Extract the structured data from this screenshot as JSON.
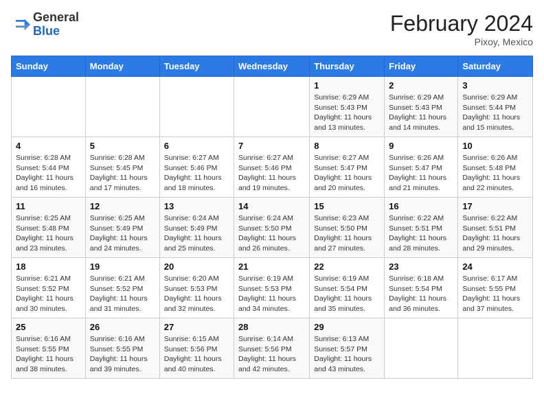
{
  "header": {
    "logo_general": "General",
    "logo_blue": "Blue",
    "month_year": "February 2024",
    "location": "Pixoy, Mexico"
  },
  "days_of_week": [
    "Sunday",
    "Monday",
    "Tuesday",
    "Wednesday",
    "Thursday",
    "Friday",
    "Saturday"
  ],
  "weeks": [
    [
      {
        "day": "",
        "info": ""
      },
      {
        "day": "",
        "info": ""
      },
      {
        "day": "",
        "info": ""
      },
      {
        "day": "",
        "info": ""
      },
      {
        "day": "1",
        "info": "Sunrise: 6:29 AM\nSunset: 5:43 PM\nDaylight: 11 hours and 13 minutes."
      },
      {
        "day": "2",
        "info": "Sunrise: 6:29 AM\nSunset: 5:43 PM\nDaylight: 11 hours and 14 minutes."
      },
      {
        "day": "3",
        "info": "Sunrise: 6:29 AM\nSunset: 5:44 PM\nDaylight: 11 hours and 15 minutes."
      }
    ],
    [
      {
        "day": "4",
        "info": "Sunrise: 6:28 AM\nSunset: 5:44 PM\nDaylight: 11 hours and 16 minutes."
      },
      {
        "day": "5",
        "info": "Sunrise: 6:28 AM\nSunset: 5:45 PM\nDaylight: 11 hours and 17 minutes."
      },
      {
        "day": "6",
        "info": "Sunrise: 6:27 AM\nSunset: 5:46 PM\nDaylight: 11 hours and 18 minutes."
      },
      {
        "day": "7",
        "info": "Sunrise: 6:27 AM\nSunset: 5:46 PM\nDaylight: 11 hours and 19 minutes."
      },
      {
        "day": "8",
        "info": "Sunrise: 6:27 AM\nSunset: 5:47 PM\nDaylight: 11 hours and 20 minutes."
      },
      {
        "day": "9",
        "info": "Sunrise: 6:26 AM\nSunset: 5:47 PM\nDaylight: 11 hours and 21 minutes."
      },
      {
        "day": "10",
        "info": "Sunrise: 6:26 AM\nSunset: 5:48 PM\nDaylight: 11 hours and 22 minutes."
      }
    ],
    [
      {
        "day": "11",
        "info": "Sunrise: 6:25 AM\nSunset: 5:48 PM\nDaylight: 11 hours and 23 minutes."
      },
      {
        "day": "12",
        "info": "Sunrise: 6:25 AM\nSunset: 5:49 PM\nDaylight: 11 hours and 24 minutes."
      },
      {
        "day": "13",
        "info": "Sunrise: 6:24 AM\nSunset: 5:49 PM\nDaylight: 11 hours and 25 minutes."
      },
      {
        "day": "14",
        "info": "Sunrise: 6:24 AM\nSunset: 5:50 PM\nDaylight: 11 hours and 26 minutes."
      },
      {
        "day": "15",
        "info": "Sunrise: 6:23 AM\nSunset: 5:50 PM\nDaylight: 11 hours and 27 minutes."
      },
      {
        "day": "16",
        "info": "Sunrise: 6:22 AM\nSunset: 5:51 PM\nDaylight: 11 hours and 28 minutes."
      },
      {
        "day": "17",
        "info": "Sunrise: 6:22 AM\nSunset: 5:51 PM\nDaylight: 11 hours and 29 minutes."
      }
    ],
    [
      {
        "day": "18",
        "info": "Sunrise: 6:21 AM\nSunset: 5:52 PM\nDaylight: 11 hours and 30 minutes."
      },
      {
        "day": "19",
        "info": "Sunrise: 6:21 AM\nSunset: 5:52 PM\nDaylight: 11 hours and 31 minutes."
      },
      {
        "day": "20",
        "info": "Sunrise: 6:20 AM\nSunset: 5:53 PM\nDaylight: 11 hours and 32 minutes."
      },
      {
        "day": "21",
        "info": "Sunrise: 6:19 AM\nSunset: 5:53 PM\nDaylight: 11 hours and 34 minutes."
      },
      {
        "day": "22",
        "info": "Sunrise: 6:19 AM\nSunset: 5:54 PM\nDaylight: 11 hours and 35 minutes."
      },
      {
        "day": "23",
        "info": "Sunrise: 6:18 AM\nSunset: 5:54 PM\nDaylight: 11 hours and 36 minutes."
      },
      {
        "day": "24",
        "info": "Sunrise: 6:17 AM\nSunset: 5:55 PM\nDaylight: 11 hours and 37 minutes."
      }
    ],
    [
      {
        "day": "25",
        "info": "Sunrise: 6:16 AM\nSunset: 5:55 PM\nDaylight: 11 hours and 38 minutes."
      },
      {
        "day": "26",
        "info": "Sunrise: 6:16 AM\nSunset: 5:55 PM\nDaylight: 11 hours and 39 minutes."
      },
      {
        "day": "27",
        "info": "Sunrise: 6:15 AM\nSunset: 5:56 PM\nDaylight: 11 hours and 40 minutes."
      },
      {
        "day": "28",
        "info": "Sunrise: 6:14 AM\nSunset: 5:56 PM\nDaylight: 11 hours and 42 minutes."
      },
      {
        "day": "29",
        "info": "Sunrise: 6:13 AM\nSunset: 5:57 PM\nDaylight: 11 hours and 43 minutes."
      },
      {
        "day": "",
        "info": ""
      },
      {
        "day": "",
        "info": ""
      }
    ]
  ]
}
